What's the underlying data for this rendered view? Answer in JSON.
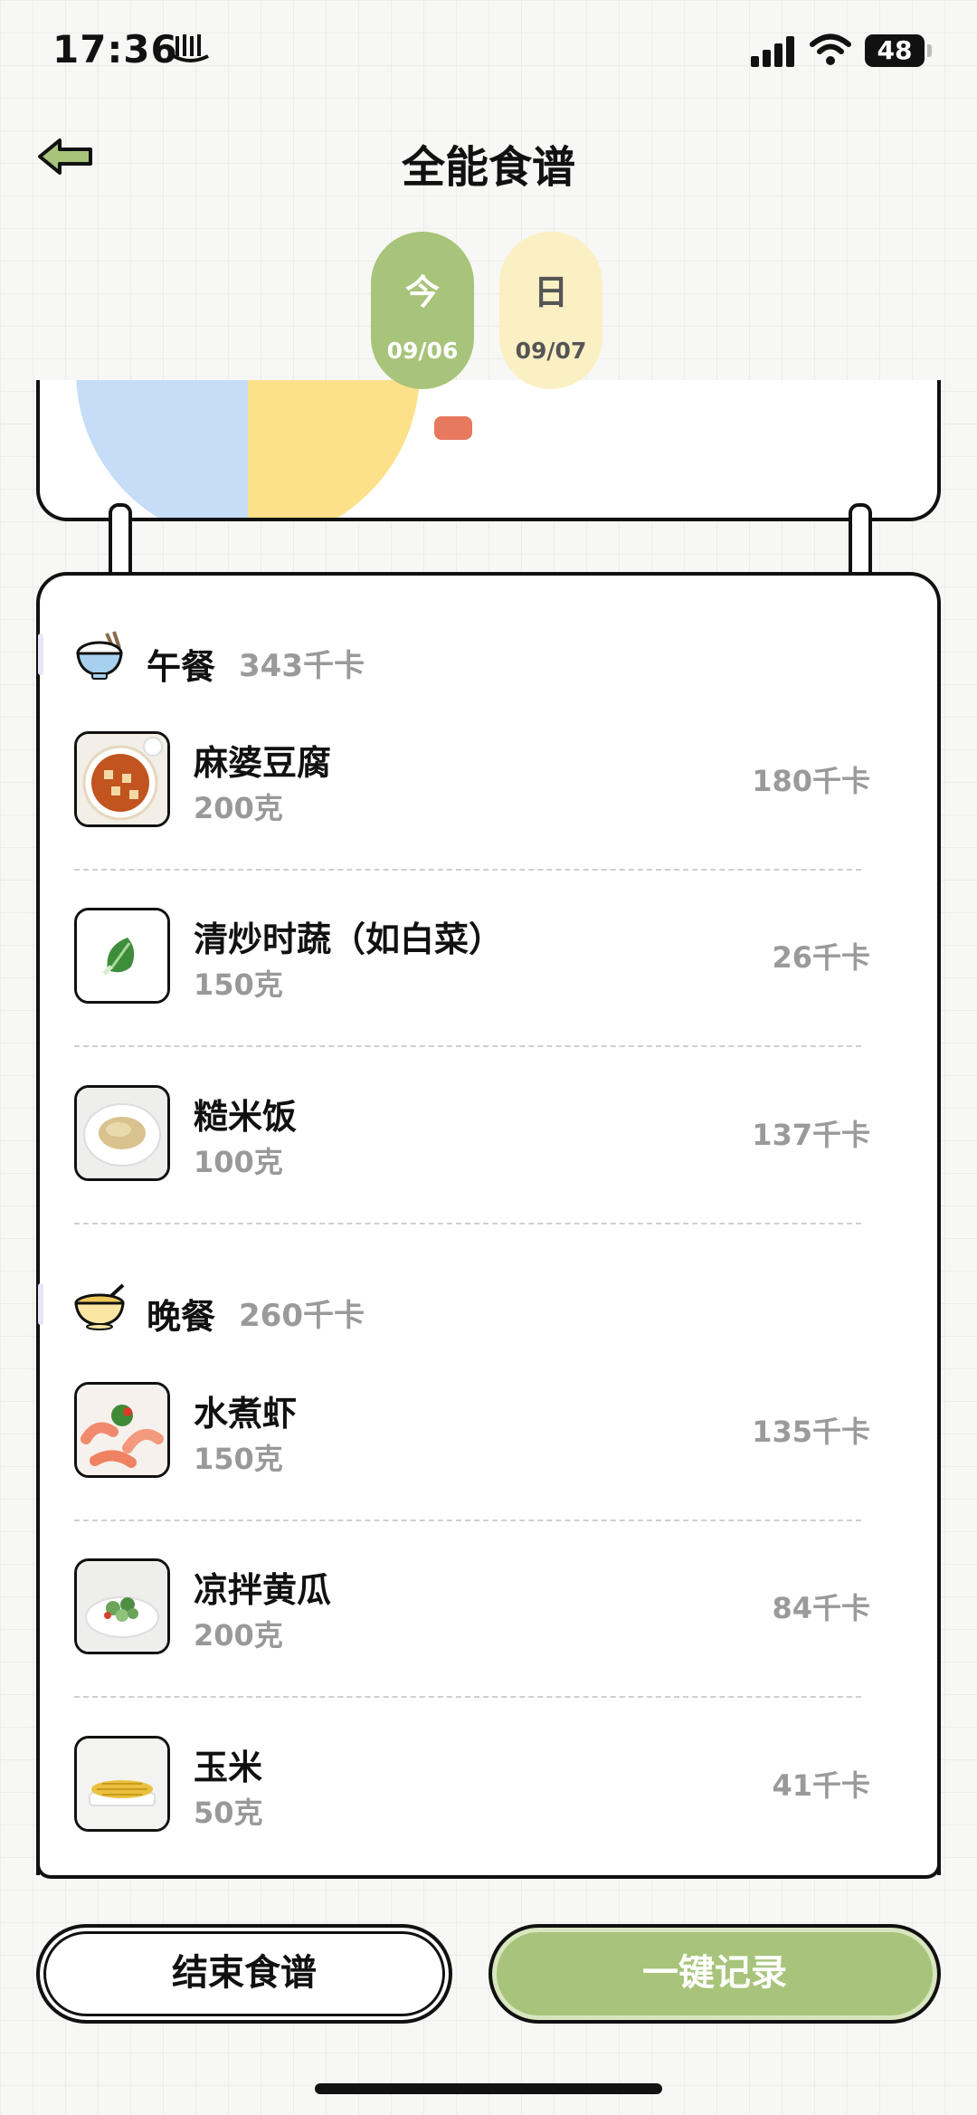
{
  "status_bar": {
    "time": "17:36",
    "battery": "48"
  },
  "header": {
    "title": "全能食谱"
  },
  "dates": [
    {
      "char": "今",
      "date": "09/06",
      "active": true
    },
    {
      "char": "日",
      "date": "09/07",
      "active": false
    }
  ],
  "meals": [
    {
      "name": "午餐",
      "kcal": "343千卡",
      "items": [
        {
          "name": "麻婆豆腐",
          "weight": "200克",
          "kcal": "180千卡"
        },
        {
          "name": "清炒时蔬（如白菜）",
          "weight": "150克",
          "kcal": "26千卡"
        },
        {
          "name": "糙米饭",
          "weight": "100克",
          "kcal": "137千卡"
        }
      ]
    },
    {
      "name": "晚餐",
      "kcal": "260千卡",
      "items": [
        {
          "name": "水煮虾",
          "weight": "150克",
          "kcal": "135千卡"
        },
        {
          "name": "凉拌黄瓜",
          "weight": "200克",
          "kcal": "84千卡"
        },
        {
          "name": "玉米",
          "weight": "50克",
          "kcal": "41千卡"
        }
      ]
    }
  ],
  "buttons": {
    "end": "结束食谱",
    "record": "一键记录"
  },
  "colors": {
    "accent_green": "#a7c47a",
    "pill_yellow": "#fbf0c4",
    "chart_blue": "#c5ddf7",
    "chart_yellow": "#fde18a"
  }
}
